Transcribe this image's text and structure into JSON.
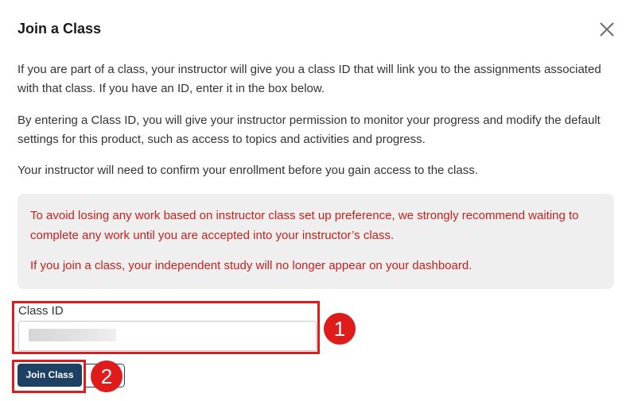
{
  "dialog": {
    "title": "Join a Class",
    "close_icon": "close-icon",
    "paragraphs": [
      "If you are part of a class, your instructor will give you a class ID that will link you to the assignments associated with that class. If you have an ID, enter it in the box below.",
      "By entering a Class ID, you will give your instructor permission to monitor your progress and modify the default settings for this product, such as access to topics and activities and progress.",
      "Your instructor will need to confirm your enrollment before you gain access to the class."
    ],
    "warning": [
      "To avoid losing any work based on instructor class set up preference, we strongly recommend waiting to complete any work until you are accepted into your instructor’s class.",
      "If you join a class, your independent study will no longer appear on your dashboard."
    ],
    "class_id": {
      "label": "Class ID",
      "value": ""
    },
    "join_button": "Join Class"
  },
  "annotations": {
    "badge_1": "1",
    "badge_2": "2"
  },
  "colors": {
    "warning_text": "#c8201e",
    "primary_button": "#1d4163",
    "highlight": "#e01b1b",
    "warning_bg": "#efefef"
  }
}
